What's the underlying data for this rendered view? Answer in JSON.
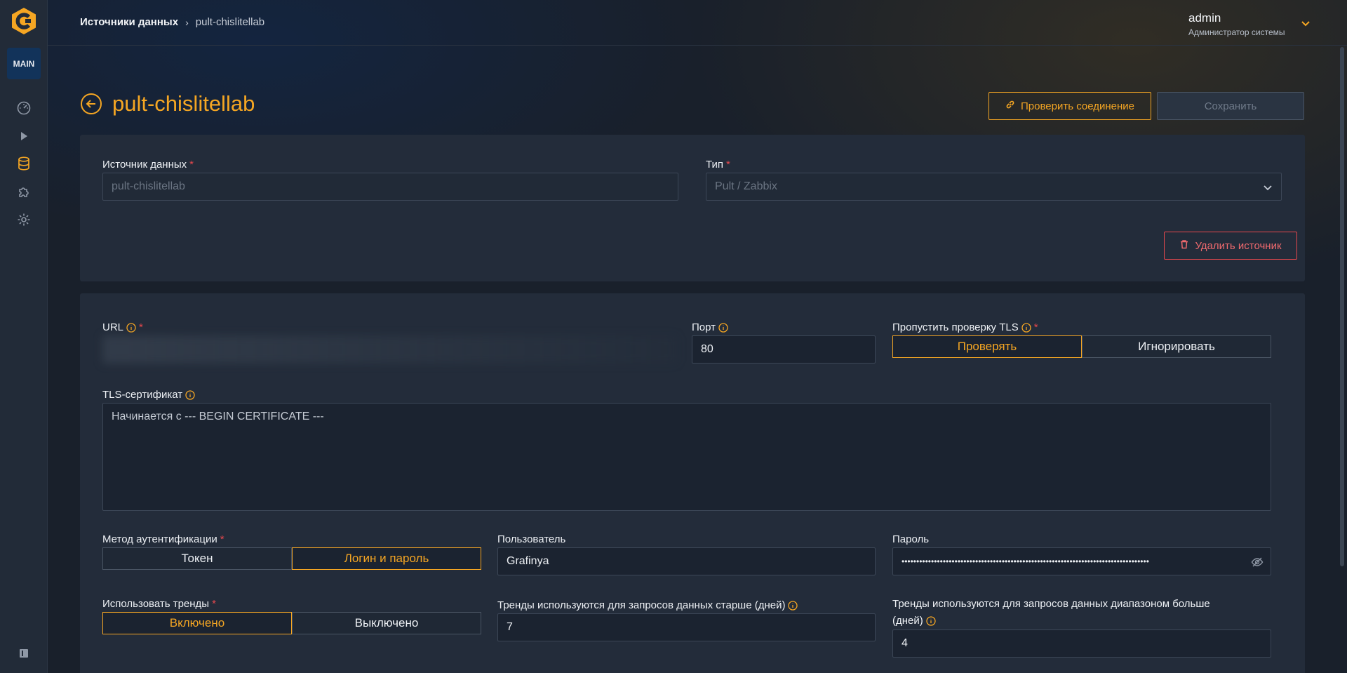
{
  "sidebar": {
    "workspace_badge": "MAIN",
    "icons": [
      "dashboard-icon",
      "play-icon",
      "database-icon",
      "plugin-icon",
      "settings-icon"
    ]
  },
  "header": {
    "breadcrumb_link": "Источники данных",
    "breadcrumb_current": "pult-chislitellab",
    "user_name": "admin",
    "user_role": "Администратор системы"
  },
  "page": {
    "title": "pult-chislitellab",
    "check_connection_label": "Проверить соединение",
    "save_label": "Сохранить"
  },
  "source_card": {
    "source_label": "Источник данных",
    "source_placeholder": "pult-chislitellab",
    "type_label": "Тип",
    "type_value": "Pult / Zabbix",
    "delete_label": "Удалить источник"
  },
  "settings_card": {
    "url_label": "URL",
    "port_label": "Порт",
    "port_value": "80",
    "tls_skip_label": "Пропустить проверку TLS",
    "tls_options": [
      "Проверять",
      "Игнорировать"
    ],
    "tls_selected": "Проверять",
    "cert_label": "TLS-сертификат",
    "cert_placeholder": "Начинается с --- BEGIN CERTIFICATE ---",
    "auth_label": "Метод аутентификации",
    "auth_options": [
      "Токен",
      "Логин и пароль"
    ],
    "auth_selected": "Логин и пароль",
    "user_label": "Пользователь",
    "user_value": "Grafinya",
    "password_label": "Пароль",
    "password_value": "••••••••••••••••••••••••••••••••••••••••••••••••••••••••••••••••••••••••••••••••••••",
    "trends_label": "Использовать тренды",
    "trends_options": [
      "Включено",
      "Выключено"
    ],
    "trends_selected": "Включено",
    "trends_older_label": "Тренды используются для запросов данных старше (дней)",
    "trends_older_value": "7",
    "trends_range_label_line1": "Тренды используются для запросов данных диапазоном больше",
    "trends_range_label_line2": "(дней)",
    "trends_range_value": "4"
  },
  "colors": {
    "accent": "#f5a623",
    "danger": "#e5484d",
    "background": "#19202b",
    "card": "#232c3a"
  }
}
